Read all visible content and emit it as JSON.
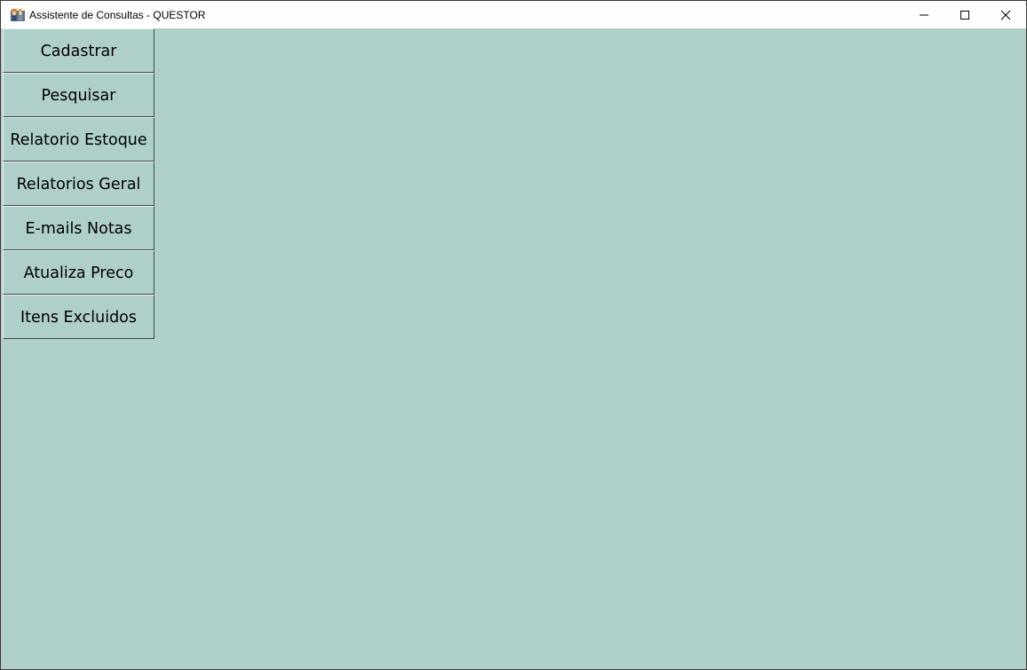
{
  "window": {
    "title": "Assistente de Consultas - QUESTOR",
    "app_icon": "app-users-icon",
    "controls": {
      "minimize_icon": "minimize-icon",
      "maximize_icon": "maximize-icon",
      "close_icon": "close-icon"
    }
  },
  "menu": {
    "items": [
      {
        "label": "Cadastrar"
      },
      {
        "label": "Pesquisar"
      },
      {
        "label": "Relatorio Estoque"
      },
      {
        "label": "Relatorios Geral"
      },
      {
        "label": "E-mails Notas"
      },
      {
        "label": "Atualiza Preco"
      },
      {
        "label": "Itens Excluidos"
      }
    ]
  },
  "colors": {
    "background": "#afcfca",
    "titlebar": "#ffffff",
    "text": "#000000"
  }
}
